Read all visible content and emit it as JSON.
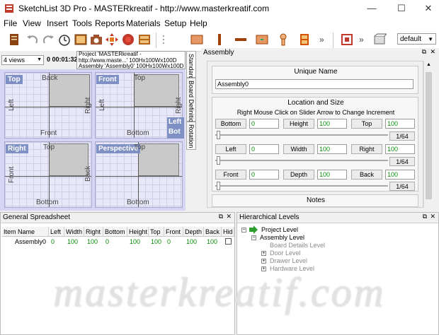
{
  "window": {
    "title": "SketchList 3D Pro - MASTERkreatif - http://www.masterkreatif.com",
    "minimize": "—",
    "maximize": "☐",
    "close": "✕"
  },
  "menu": [
    "File",
    "View",
    "Insert",
    "Tools",
    "Reports",
    "Materials",
    "Setup",
    "Help"
  ],
  "toolbar": {
    "icons": [
      "new-document-icon",
      "undo-icon",
      "redo-icon",
      "clock-icon",
      "picture-icon",
      "camera-icon",
      "move-arrows-icon",
      "record-icon",
      "board-layout-icon",
      "panel-icon",
      "vertical-board-icon",
      "horizontal-board-icon",
      "drawer-front-icon",
      "hinge-icon",
      "cabinet-door-icon",
      "expand-icon",
      "snap-icon",
      "box-3d-icon"
    ],
    "combo_value": "default"
  },
  "views": {
    "count_label": "4 views",
    "timer": "0 00:01:32",
    "project_line1": "Project 'MASTERkreatif -",
    "project_line2": "http://www.maste...' 100Hx100Wx100D",
    "assembly_line": "Assembly 'Assembly0' 100Hx100Wx100D",
    "viewports": [
      {
        "tag": "Top",
        "top_label": "Back",
        "bottom_label": "Front",
        "left_label": "Left",
        "right_label": "Right"
      },
      {
        "tag": "Front",
        "top_label": "Top",
        "bottom_label": "Bottom",
        "left_label": "Left",
        "right_label": "Right"
      },
      {
        "tag": "Right",
        "top_label": "Top",
        "bottom_label": "Bottom",
        "left_label": "Front",
        "right_label": "Back"
      },
      {
        "tag": "Perspective",
        "top_label": "Top",
        "bottom_label": "Bottom",
        "left_label": "",
        "right_label": ""
      }
    ],
    "side_tag_1": "Left",
    "side_tag_2": "Bot"
  },
  "vertical_tabs": [
    "Standard",
    "Board Definition",
    "Rotation"
  ],
  "assembly_panel": {
    "header": "Assembly",
    "unique_name_title": "Unique Name",
    "unique_name_value": "Assembly0",
    "location_title": "Location and Size",
    "increment_hint": "Right Mouse Click on Slider Arrow to Change Increment",
    "rows": [
      {
        "b1": "Bottom",
        "v1": "0",
        "b2": "Height",
        "v2": "100",
        "b3": "Top",
        "v3": "100",
        "inc": "1/64"
      },
      {
        "b1": "Left",
        "v1": "0",
        "b2": "Width",
        "v2": "100",
        "b3": "Right",
        "v3": "100",
        "inc": "1/64"
      },
      {
        "b1": "Front",
        "v1": "0",
        "b2": "Depth",
        "v2": "100",
        "b3": "Back",
        "v3": "100",
        "inc": "1/64"
      }
    ],
    "notes_title": "Notes"
  },
  "spreadsheet": {
    "header": "General Spreadsheet",
    "columns": [
      "Item Name",
      "Left",
      "Width",
      "Right",
      "Bottom",
      "Height",
      "Top",
      "Front",
      "Depth",
      "Back",
      "Hid"
    ],
    "row": [
      "Assembly0",
      "0",
      "100",
      "100",
      "0",
      "100",
      "100",
      "0",
      "100",
      "100",
      ""
    ]
  },
  "hierarchy": {
    "header": "Hierarchical Levels",
    "project": "Project Level",
    "assembly": "Assembly Level",
    "children": [
      "Board Details Level",
      "Door Level",
      "Drawer Level",
      "Hardware Level"
    ]
  },
  "watermark": "masterkreatif.com",
  "colors": {
    "accent_tag": "#7f91c4",
    "green_value": "#0a8a0a",
    "view_bg": "#d6d6f4"
  }
}
